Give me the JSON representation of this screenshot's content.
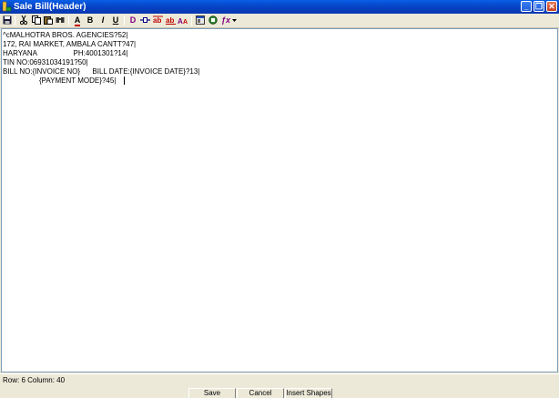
{
  "window": {
    "title": "Sale Bill(Header)",
    "controls": {
      "minimize": "_",
      "restore": "❐",
      "close": "✕"
    }
  },
  "toolbar": {
    "bold_label": "B",
    "italic_label": "I",
    "underline_label": "U",
    "font_label": "A",
    "d_label": "D",
    "fx_label": "ƒx"
  },
  "editor": {
    "lines": [
      "^cMALHOTRA BROS. AGENCIES?52|",
      "172, RAI MARKET, AMBALA CANTT?47|",
      "HARYANA                  PH:4001301?14|",
      "TIN NO:06931034191?50|",
      "BILL NO:{INVOICE NO}      BILL DATE:{INVOICE DATE}?13|",
      "                  {PAYMENT MODE}?45|"
    ]
  },
  "status": {
    "text": "Row: 6  Column: 40"
  },
  "buttons": {
    "save": "Save",
    "cancel": "Cancel",
    "insert_shapes": "Insert Shapes"
  },
  "colors": {
    "title_bar": "#0543c4",
    "accent_red": "#c00000",
    "accent_purple": "#800080",
    "background": "#ece9d8"
  }
}
